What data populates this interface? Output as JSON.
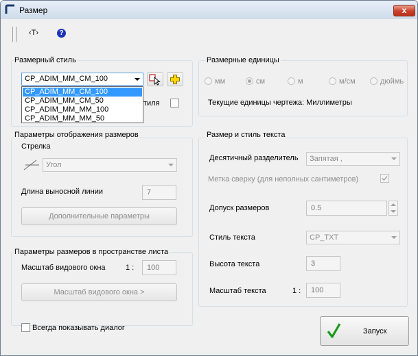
{
  "window": {
    "title": "Размер",
    "close_glyph": "x"
  },
  "toolbar": {
    "text_tool_label": "‹T›",
    "help_glyph": "?"
  },
  "dimension_style": {
    "group_label": "Размерный стиль",
    "selected": "CP_ADIM_MM_CM_100",
    "options": [
      "CP_ADIM_MM_CM_100",
      "CP_ADIM_MM_CM_50",
      "CP_ADIM_MM_MM_100",
      "CP_ADIM_MM_MM_50"
    ],
    "hidden_checkbox_label_tail": "тиля"
  },
  "units": {
    "group_label": "Размерные единицы",
    "options": [
      "мм",
      "см",
      "м",
      "м/см",
      "дюймь"
    ],
    "selected": "см",
    "current_label": "Текущие единицы чертежа: Миллиметры"
  },
  "display": {
    "group_label": "Параметры отображения размеров",
    "arrow_label": "Стрелка",
    "arrow_value": "Угол",
    "ext_line_label": "Длина выносной линии",
    "ext_line_value": "7",
    "extra_button": "Дополнительные параметры"
  },
  "sheet": {
    "group_label": "Параметры размеров в пространстве листа",
    "viewport_scale_label": "Масштаб видового окна",
    "ratio_prefix": "1 :",
    "viewport_scale_value": "100",
    "viewport_scale_button": "Масштаб видового окна >"
  },
  "text": {
    "group_label": "Размер и стиль текста",
    "decimal_label": "Десятичный разделитель",
    "decimal_value": "Запятая ,",
    "superscript_label": "Метка сверху (для неполных сантиметров)",
    "tolerance_label": "Допуск размеров",
    "tolerance_value": "0.5",
    "text_style_label": "Стиль текста",
    "text_style_value": "CP_TXT",
    "text_height_label": "Высота текста",
    "text_height_value": "3",
    "text_scale_label": "Масштаб текста",
    "ratio_prefix": "1 :",
    "text_scale_value": "100"
  },
  "footer": {
    "always_show_label": "Всегда показывать диалог",
    "run_button": "Запуск"
  },
  "colors": {
    "selection": "#3399ff",
    "close_button": "#c9412b",
    "check_green": "#1a9a1a"
  }
}
